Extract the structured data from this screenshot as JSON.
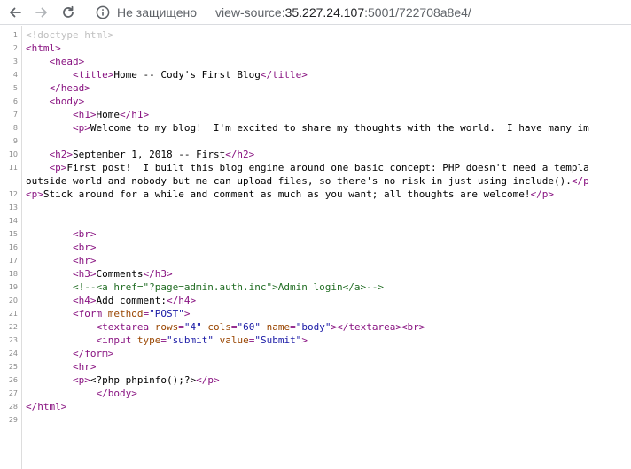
{
  "browser": {
    "back_icon": "arrow-left-icon",
    "forward_icon": "arrow-right-icon",
    "reload_icon": "reload-icon",
    "info_icon": "info-circle-icon",
    "security_label": "Не защищено",
    "url_scheme": "view-source:",
    "url_host": "35.227.24.107",
    "url_path": ":5001/722708a8e4/"
  },
  "source": {
    "lines": [
      {
        "num": "1",
        "segs": [
          [
            "d",
            "<!doctype html>"
          ]
        ]
      },
      {
        "num": "2",
        "segs": [
          [
            "t",
            "<html>"
          ]
        ]
      },
      {
        "num": "3",
        "segs": [
          [
            "tx",
            "    "
          ],
          [
            "t",
            "<head>"
          ]
        ]
      },
      {
        "num": "4",
        "segs": [
          [
            "tx",
            "        "
          ],
          [
            "t",
            "<title>"
          ],
          [
            "tx",
            "Home -- Cody's First Blog"
          ],
          [
            "t",
            "</title>"
          ]
        ]
      },
      {
        "num": "5",
        "segs": [
          [
            "tx",
            "    "
          ],
          [
            "t",
            "</head>"
          ]
        ]
      },
      {
        "num": "6",
        "segs": [
          [
            "tx",
            "    "
          ],
          [
            "t",
            "<body>"
          ]
        ]
      },
      {
        "num": "7",
        "segs": [
          [
            "tx",
            "        "
          ],
          [
            "t",
            "<h1>"
          ],
          [
            "tx",
            "Home"
          ],
          [
            "t",
            "</h1>"
          ]
        ]
      },
      {
        "num": "8",
        "segs": [
          [
            "tx",
            "        "
          ],
          [
            "t",
            "<p>"
          ],
          [
            "tx",
            "Welcome to my blog!  I'm excited to share my thoughts with the world.  I have many im"
          ]
        ]
      },
      {
        "num": "9",
        "segs": []
      },
      {
        "num": "10",
        "segs": [
          [
            "tx",
            "    "
          ],
          [
            "t",
            "<h2>"
          ],
          [
            "tx",
            "September 1, 2018 -- First"
          ],
          [
            "t",
            "</h2>"
          ]
        ]
      },
      {
        "num": "11",
        "segs": [
          [
            "tx",
            "    "
          ],
          [
            "t",
            "<p>"
          ],
          [
            "tx",
            "First post!  I built this blog engine around one basic concept: PHP doesn't need a templa"
          ]
        ]
      },
      {
        "num": "",
        "segs": [
          [
            "tx",
            "outside world and nobody but me can upload files, so there's no risk in just using include()."
          ],
          [
            "t",
            "</p"
          ]
        ]
      },
      {
        "num": "12",
        "segs": [
          [
            "t",
            "<p>"
          ],
          [
            "tx",
            "Stick around for a while and comment as much as you want; all thoughts are welcome!"
          ],
          [
            "t",
            "</p>"
          ]
        ]
      },
      {
        "num": "13",
        "segs": []
      },
      {
        "num": "14",
        "segs": []
      },
      {
        "num": "15",
        "segs": [
          [
            "tx",
            "        "
          ],
          [
            "t",
            "<br>"
          ]
        ]
      },
      {
        "num": "16",
        "segs": [
          [
            "tx",
            "        "
          ],
          [
            "t",
            "<br>"
          ]
        ]
      },
      {
        "num": "17",
        "segs": [
          [
            "tx",
            "        "
          ],
          [
            "t",
            "<hr>"
          ]
        ]
      },
      {
        "num": "18",
        "segs": [
          [
            "tx",
            "        "
          ],
          [
            "t",
            "<h3>"
          ],
          [
            "tx",
            "Comments"
          ],
          [
            "t",
            "</h3>"
          ]
        ]
      },
      {
        "num": "19",
        "segs": [
          [
            "tx",
            "        "
          ],
          [
            "c",
            "<!--<a href=\"?page=admin.auth.inc\">Admin login</a>-->"
          ]
        ]
      },
      {
        "num": "20",
        "segs": [
          [
            "tx",
            "        "
          ],
          [
            "t",
            "<h4>"
          ],
          [
            "tx",
            "Add comment:"
          ],
          [
            "t",
            "</h4>"
          ]
        ]
      },
      {
        "num": "21",
        "segs": [
          [
            "tx",
            "        "
          ],
          [
            "t",
            "<form "
          ],
          [
            "a",
            "method"
          ],
          [
            "t",
            "="
          ],
          [
            "v",
            "\"POST\""
          ],
          [
            "t",
            ">"
          ]
        ]
      },
      {
        "num": "22",
        "segs": [
          [
            "tx",
            "            "
          ],
          [
            "t",
            "<textarea "
          ],
          [
            "a",
            "rows"
          ],
          [
            "t",
            "="
          ],
          [
            "v",
            "\"4\""
          ],
          [
            "t",
            " "
          ],
          [
            "a",
            "cols"
          ],
          [
            "t",
            "="
          ],
          [
            "v",
            "\"60\""
          ],
          [
            "t",
            " "
          ],
          [
            "a",
            "name"
          ],
          [
            "t",
            "="
          ],
          [
            "v",
            "\"body\""
          ],
          [
            "t",
            "></textarea><br>"
          ]
        ]
      },
      {
        "num": "23",
        "segs": [
          [
            "tx",
            "            "
          ],
          [
            "t",
            "<input "
          ],
          [
            "a",
            "type"
          ],
          [
            "t",
            "="
          ],
          [
            "v",
            "\"submit\""
          ],
          [
            "t",
            " "
          ],
          [
            "a",
            "value"
          ],
          [
            "t",
            "="
          ],
          [
            "v",
            "\"Submit\""
          ],
          [
            "t",
            ">"
          ]
        ]
      },
      {
        "num": "24",
        "segs": [
          [
            "tx",
            "        "
          ],
          [
            "t",
            "</form>"
          ]
        ]
      },
      {
        "num": "25",
        "segs": [
          [
            "tx",
            "        "
          ],
          [
            "t",
            "<hr>"
          ]
        ]
      },
      {
        "num": "26",
        "segs": [
          [
            "tx",
            "        "
          ],
          [
            "t",
            "<p>"
          ],
          [
            "tx",
            "<?php phpinfo();?>"
          ],
          [
            "t",
            "</p>"
          ]
        ]
      },
      {
        "num": "27",
        "segs": [
          [
            "tx",
            "            "
          ],
          [
            "t",
            "</body>"
          ]
        ]
      },
      {
        "num": "28",
        "segs": [
          [
            "t",
            "</html>"
          ]
        ]
      },
      {
        "num": "29",
        "segs": []
      }
    ]
  }
}
